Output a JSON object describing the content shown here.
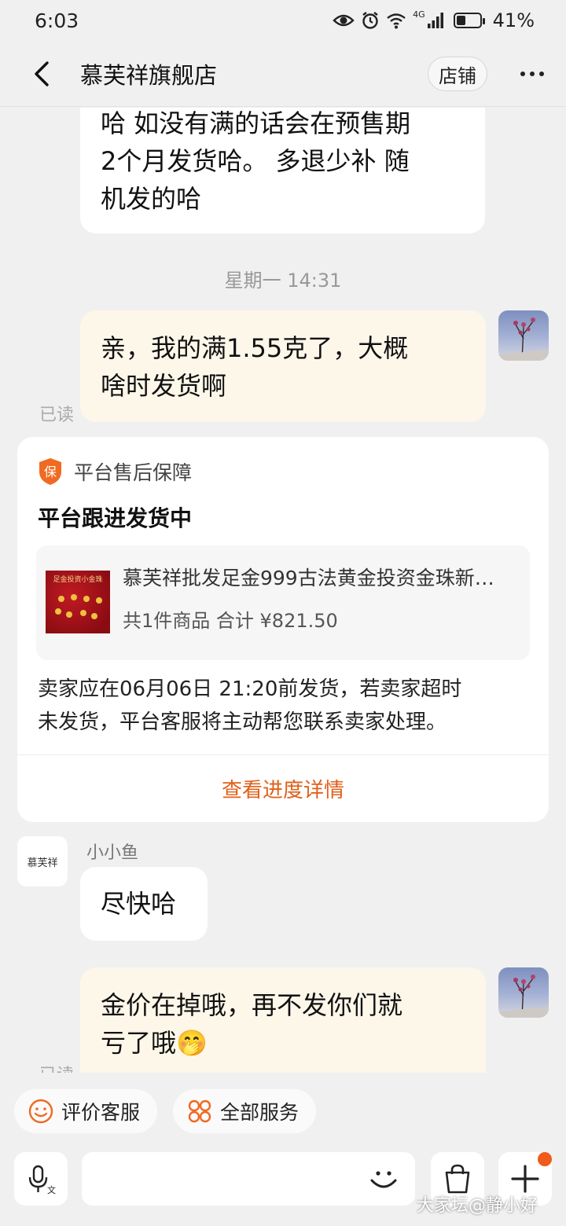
{
  "status_bar": {
    "time": "6:03",
    "network": "4G",
    "battery": "41%",
    "battery_level": 0.41
  },
  "header": {
    "title": "慕芙祥旗舰店",
    "shop_button": "店铺"
  },
  "messages": {
    "msg1_line1": "哈 如没有满的话会在预售期",
    "msg1_line2": "2个月发货哈。 多退少补 随",
    "msg1_line3": "机发的哈",
    "timestamp": "星期一 14:31",
    "msg2_line1": "亲，我的满1.55克了，大概",
    "msg2_line2": "啥时发货啊",
    "read_label": "已读",
    "shop_avatar_text": "慕芙祥",
    "sender_name": "小小鱼",
    "msg3": "尽快哈",
    "msg4_line1": "金价在掉哦，再不发你们就",
    "msg4_line2": "亏了哦",
    "msg4_emoji": "🤭"
  },
  "card": {
    "badge_char": "保",
    "brand_label": "平台售后保障",
    "title": "平台跟进发货中",
    "product_thumb_text": "足金投资小金珠",
    "product_name": "慕芙祥批发足金999古法黄金投资金珠新…",
    "product_summary": "共1件商品 合计 ¥821.50",
    "notice_line1": "卖家应在06月06日 21:20前发货，若卖家超时",
    "notice_line2": "未发货，平台客服将主动帮您联系卖家处理。",
    "link": "查看进度详情"
  },
  "quick_actions": {
    "rate_service": "评价客服",
    "all_services": "全部服务"
  },
  "input": {
    "placeholder": ""
  },
  "watermark": "大家坛@静小好",
  "colors": {
    "accent": "#e0601a",
    "outgoing_bubble": "#fdf7ea",
    "background": "#f0f0f0"
  }
}
